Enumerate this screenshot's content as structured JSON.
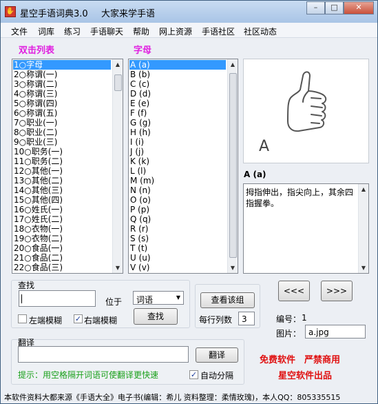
{
  "window": {
    "title": "星空手语词典3.0",
    "subtitle": "大家来学手语",
    "controls": {
      "minimize": "–",
      "maximize": "□",
      "close": "✕"
    }
  },
  "menu": [
    "文件",
    "词库",
    "练习",
    "手语聊天",
    "帮助",
    "网上资源",
    "手语社区",
    "社区动态"
  ],
  "left_list": {
    "label": "双击列表",
    "items": [
      "1○字母",
      "2○称谓(一)",
      "3○称谓(二)",
      "4○称谓(三)",
      "5○称谓(四)",
      "6○称谓(五)",
      "7○职业(一)",
      "8○职业(二)",
      "9○职业(三)",
      "10○职务(一)",
      "11○职务(二)",
      "12○其他(一)",
      "13○其他(二)",
      "14○其他(三)",
      "15○其他(四)",
      "16○姓氏(一)",
      "17○姓氏(二)",
      "18○衣物(一)",
      "19○衣物(二)",
      "20○食品(一)",
      "21○食品(二)",
      "22○食品(三)"
    ],
    "selected_index": 0
  },
  "right_list": {
    "label": "字母",
    "items": [
      "A (a)",
      "B (b)",
      "C (c)",
      "D (d)",
      "E (e)",
      "F (f)",
      "G (g)",
      "H (h)",
      "I (i)",
      "J (j)",
      "K (k)",
      "L (l)",
      "M (m)",
      "N (n)",
      "O (o)",
      "P (p)",
      "Q (q)",
      "R (r)",
      "S (s)",
      "T (t)",
      "U (u)",
      "V (v)"
    ],
    "selected_index": 0
  },
  "preview": {
    "image_letter": "A",
    "char_title": "A (a)",
    "description": "拇指伸出，指尖向上，其余四指握拳。"
  },
  "search": {
    "group_label": "查找",
    "input_value": "",
    "position_label": "位于",
    "scope_selected": "词语",
    "left_fuzzy_label": "左端模糊",
    "left_fuzzy_checked": false,
    "right_fuzzy_label": "右端模糊",
    "right_fuzzy_checked": true,
    "find_button": "查找"
  },
  "group_view": {
    "view_button": "查看该组",
    "cols_label": "每行列数",
    "cols_value": "3"
  },
  "nav": {
    "prev": "<<<",
    "next": ">>>"
  },
  "info": {
    "id_label": "编号：",
    "id_value": "1",
    "image_label": "图片：",
    "image_value": "a.jpg"
  },
  "translate": {
    "group_label": "翻译",
    "input_value": "",
    "button": "翻译",
    "hint": "提示：用空格隔开词语可使翻译更快速",
    "auto_split_label": "自动分隔",
    "auto_split_checked": true
  },
  "promo": {
    "line1": "免费软件　严禁商用",
    "line2": "星空软件出品"
  },
  "status": "本软件资料大都来源《手语大全》电子书(编辑：希儿 资料整理：柔情玫瑰)，本人QQ：805335515",
  "colors": {
    "accent_label": "#e020e0",
    "selection": "#3399ff",
    "promo": "#e01010",
    "hint": "#1aa01a"
  }
}
